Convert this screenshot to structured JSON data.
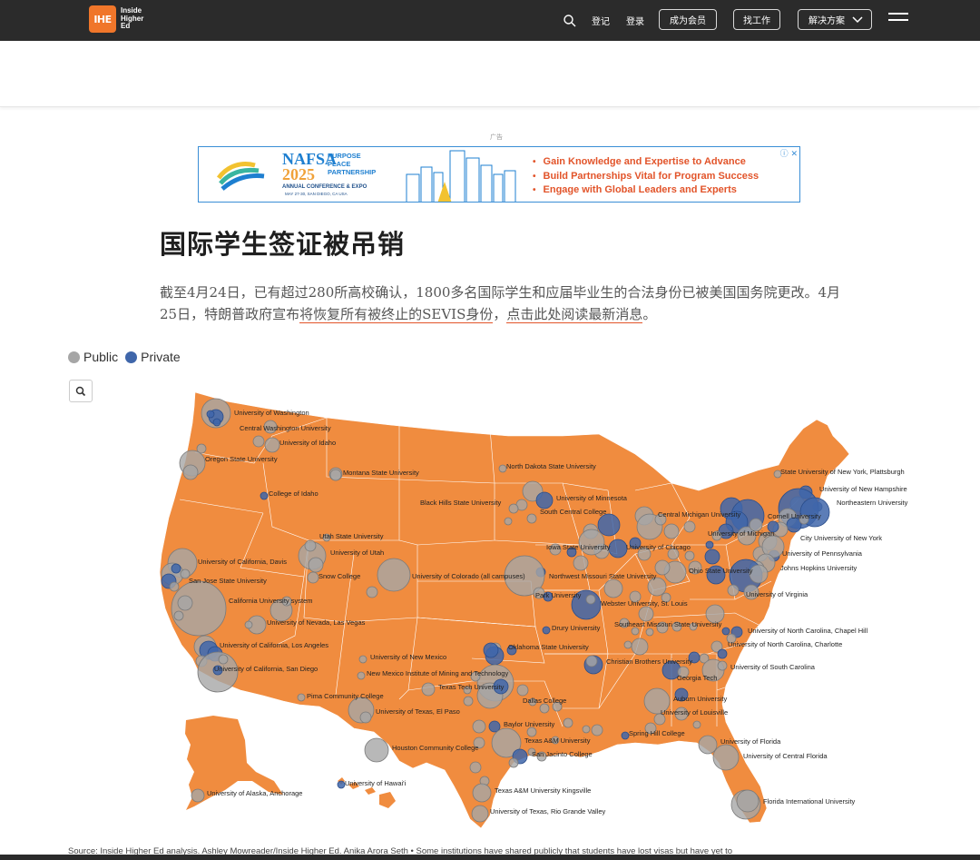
{
  "nav": {
    "logo_mark": "IHE",
    "logo_text": [
      "Inside",
      "Higher",
      "Ed"
    ],
    "register": "登记",
    "login": "登录",
    "become_member": "成为会员",
    "find_job": "找工作",
    "solutions": "解决方案"
  },
  "ad": {
    "label": "广告",
    "brand": "NAFSA",
    "year": "2025",
    "tagline": [
      "PURPOSE",
      "PLACE",
      "PARTNERSHIP"
    ],
    "conference": "ANNUAL CONFERENCE & EXPO",
    "dates": "MAY 27-30, SAN DIEGO, CA USA",
    "bullets": [
      "Gain Knowledge and Expertise to Advance",
      "Build Partnerships Vital for Program Success",
      "Engage with Global Leaders and Experts"
    ],
    "close": "ⓘ ✕"
  },
  "article": {
    "title": "国际学生签证被吊销",
    "intro_prefix": "截至4月24日，已有超过280所高校确认，1800多名国际学生和应届毕业生的合法身份已被美国国务院更改。4月25日，特朗普政府宣布",
    "intro_link1": "将恢复所有被终止的SEVIS身份",
    "intro_mid": "，",
    "intro_link2": "点击此处阅读最新消息",
    "intro_suffix": "。"
  },
  "legend": {
    "public": "Public",
    "private": "Private",
    "public_color": "#a6a6a6",
    "private_color": "#3f66aa"
  },
  "map": {
    "land_color": "#f08c3f",
    "labels": [
      "University of Washington",
      "Central Washington University",
      "University of Idaho",
      "Oregon State University",
      "Montana State University",
      "College of Idaho",
      "North Dakota State University",
      "State University of New York,  Plattsburgh",
      "University of New Hampshire",
      "Northeastern University",
      "University of Minnesota",
      "Black Hills State University",
      "South Central College",
      "Central Michigan University",
      "Cornell University",
      "Utah State University",
      "University of Utah",
      "University of California,  Davis",
      "Iowa State University",
      "University of Chicago",
      "University of Michigan",
      "City University of New York",
      "University of  Pennsylvania",
      "San Jose State University",
      "Snow College",
      "University  of Colorado (all campuses)",
      "Northwest  Missouri State University",
      "Ohio State University",
      "Johns Hopkins University",
      "California University system",
      "Park University",
      "Webster University, St. Louis",
      "University of Virginia",
      "University of Nevada, Las Vegas",
      "Drury University",
      "Southeast Missouri State University",
      "University  of North Carolina, Chapel Hill",
      "University of California, Los  Angeles",
      "Oklahoma State University",
      "University  of North Carolina, Charlotte",
      "University of New Mexico",
      "Christian Brothers University",
      "University of California, San  Diego",
      "New  Mexico Institute of Mining and Technology",
      "Georgia Tech",
      "University of South Carolina",
      "Texas Tech University",
      "Pima Community College",
      "Dallas College",
      "Auburn University",
      "University of Texas, El Paso",
      "University of Louisville",
      "Baylor University",
      "Spring Hill College",
      "Texas A&M University",
      "University of Florida",
      "Houston Community College",
      "San Jacinto College",
      "University of Central Florida",
      "University of Hawai'i",
      "University of Alaska, Anchorage",
      "Texas A&M University  Kingsville",
      "Florida International  University",
      "University  of Texas, Rio Grande Valley"
    ]
  },
  "source": "Source: Inside Higher Ed analysis. Ashley Mowreader/Inside Higher Ed. Anika Arora Seth • Some institutions have shared publicly that students have lost visas but have yet to"
}
